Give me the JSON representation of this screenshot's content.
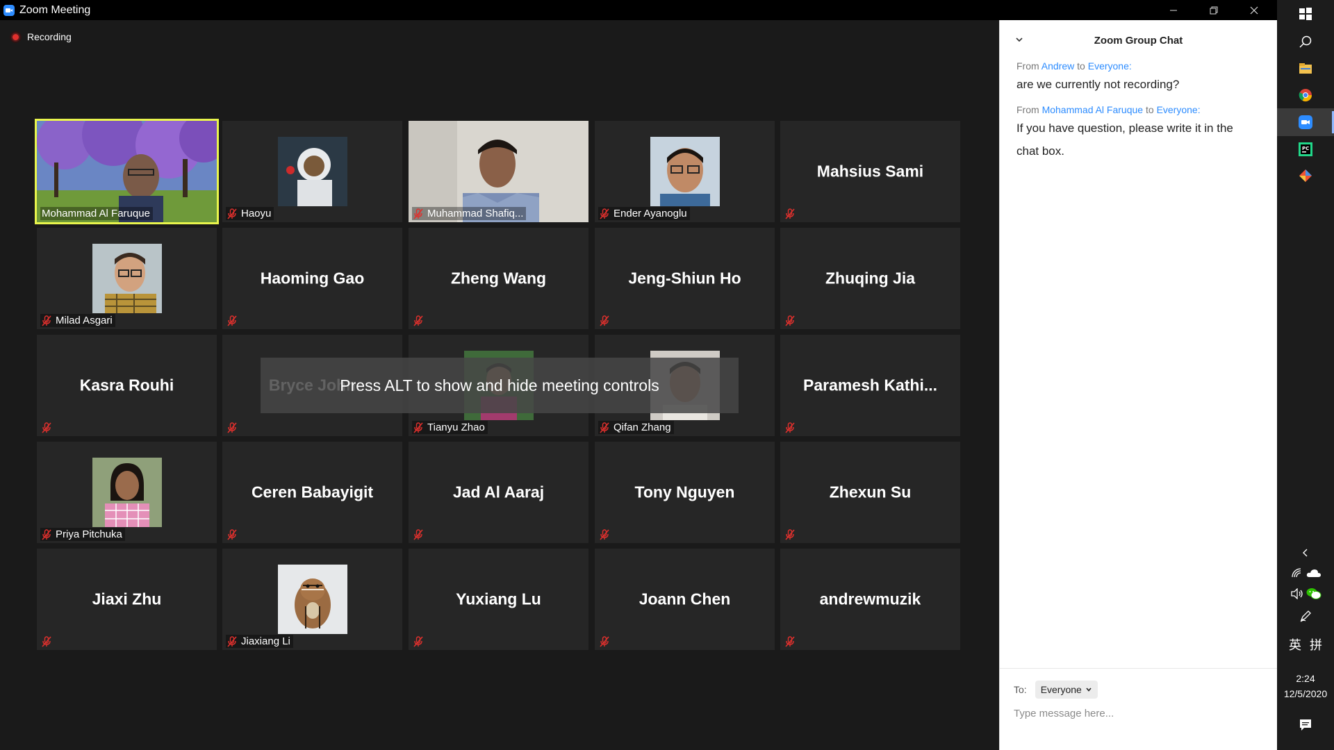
{
  "window": {
    "title": "Zoom Meeting"
  },
  "stage": {
    "recording_label": "Recording",
    "overlay_text": "Press ALT to show and hide meeting controls"
  },
  "participants": [
    {
      "name": "Mohammad Al Faruque",
      "display": "Mohammad Al Faruque",
      "video": true,
      "photo": "purple-tree-video",
      "muted": false,
      "active_speaker": true
    },
    {
      "name": "Haoyu",
      "display": "Haoyu",
      "video": false,
      "photo": "astronaut-avatar",
      "muted": true
    },
    {
      "name": "Muhammad Shafiq...",
      "display": "Muhammad Shafiq...",
      "video": true,
      "photo": "man-webcam-video",
      "muted": true
    },
    {
      "name": "Ender Ayanoglu",
      "display": "Ender Ayanoglu",
      "video": false,
      "photo": "man-glasses-avatar",
      "muted": true
    },
    {
      "name": "Mahsius Sami",
      "display": "Mahsius Sami",
      "video": false,
      "photo": null,
      "muted": true
    },
    {
      "name": "Milad Asgari",
      "display": "Milad Asgari",
      "video": false,
      "photo": "man-glasses-plaid-avatar",
      "muted": true
    },
    {
      "name": "Haoming Gao",
      "display": "Haoming Gao",
      "video": false,
      "photo": null,
      "muted": true
    },
    {
      "name": "Zheng Wang",
      "display": "Zheng Wang",
      "video": false,
      "photo": null,
      "muted": true
    },
    {
      "name": "Jeng-Shiun Ho",
      "display": "Jeng-Shiun Ho",
      "video": false,
      "photo": null,
      "muted": true
    },
    {
      "name": "Zhuqing Jia",
      "display": "Zhuqing Jia",
      "video": false,
      "photo": null,
      "muted": true
    },
    {
      "name": "Kasra Rouhi",
      "display": "Kasra Rouhi",
      "video": false,
      "photo": null,
      "muted": true
    },
    {
      "name": "Bryce John",
      "display": "Bryce John",
      "video": false,
      "photo": null,
      "muted": true
    },
    {
      "name": "Tianyu Zhao",
      "display": "Tianyu Zhao",
      "video": false,
      "photo": "man-outdoor-avatar",
      "muted": true
    },
    {
      "name": "Qifan Zhang",
      "display": "Qifan Zhang",
      "video": false,
      "photo": "man-portrait-avatar",
      "muted": true
    },
    {
      "name": "Paramesh Kathi...",
      "display": "Paramesh  Kathi...",
      "video": false,
      "photo": null,
      "muted": true
    },
    {
      "name": "Priya Pitchuka",
      "display": "Priya Pitchuka",
      "video": false,
      "photo": "woman-plaid-avatar",
      "muted": true
    },
    {
      "name": "Ceren Babayigit",
      "display": "Ceren Babayigit",
      "video": false,
      "photo": null,
      "muted": true
    },
    {
      "name": "Jad Al Aaraj",
      "display": "Jad Al Aaraj",
      "video": false,
      "photo": null,
      "muted": true
    },
    {
      "name": "Tony Nguyen",
      "display": "Tony Nguyen",
      "video": false,
      "photo": null,
      "muted": true
    },
    {
      "name": "Zhexun Su",
      "display": "Zhexun Su",
      "video": false,
      "photo": null,
      "muted": true
    },
    {
      "name": "Jiaxi Zhu",
      "display": "Jiaxi Zhu",
      "video": false,
      "photo": null,
      "muted": true
    },
    {
      "name": "Jiaxiang Li",
      "display": "Jiaxiang Li",
      "video": false,
      "photo": "chipmunk-avatar",
      "muted": true
    },
    {
      "name": "Yuxiang Lu",
      "display": "Yuxiang Lu",
      "video": false,
      "photo": null,
      "muted": true
    },
    {
      "name": "Joann Chen",
      "display": "Joann Chen",
      "video": false,
      "photo": null,
      "muted": true
    },
    {
      "name": "andrewmuzik",
      "display": "andrewmuzik",
      "video": false,
      "photo": null,
      "muted": true
    }
  ],
  "chat": {
    "title": "Zoom Group Chat",
    "messages": [
      {
        "from_prefix": "From",
        "from": "Andrew",
        "to_word": "to",
        "to": "Everyone:",
        "text": "are we currently not recording?"
      },
      {
        "from_prefix": "From",
        "from": "Mohammad Al Faruque",
        "to_word": "to",
        "to": "Everyone:",
        "text": "If you have question, please write it in the chat box."
      }
    ],
    "to_label": "To:",
    "recipient": "Everyone",
    "input_placeholder": "Type message here..."
  },
  "taskbar": {
    "apps": [
      "windows-start-icon",
      "search-icon",
      "file-explorer-icon",
      "chrome-icon",
      "zoom-icon",
      "pycharm-icon",
      "git-icon"
    ],
    "tray_icons": [
      "chevron-left-icon",
      "wifi-icon",
      "onedrive-icon",
      "volume-icon",
      "wechat-icon",
      "pen-icon"
    ],
    "ime_lang": "英",
    "ime_mode": "拼",
    "time": "2:24",
    "date": "12/5/2020",
    "notifications": "action-center-icon"
  },
  "colors": {
    "accent": "#2d8cff",
    "active_speaker": "#e9f54c",
    "tile_bg": "#262626",
    "stage_bg": "#1a1a1a",
    "mute_red": "#e0302d"
  }
}
